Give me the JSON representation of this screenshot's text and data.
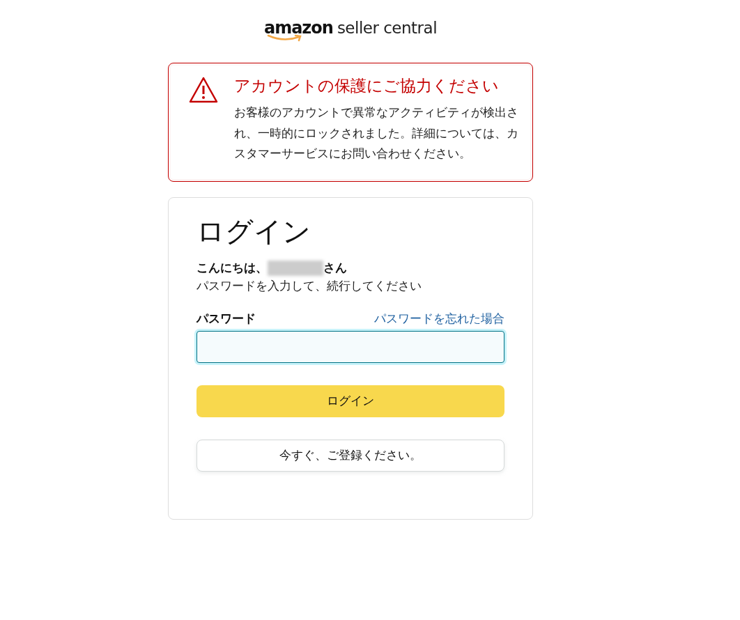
{
  "logo": {
    "brand": "amazon",
    "product": "seller central"
  },
  "alert": {
    "title": "アカウントの保護にご協力ください",
    "message": "お客様のアカウントで異常なアクティビティが検出され、一時的にロックされました。詳細については、カスタマーサービスにお問い合わせください。"
  },
  "login": {
    "heading": "ログイン",
    "greeting_prefix": "こんにちは、",
    "greeting_suffix": "さん",
    "name_redacted": true,
    "instruction": "パスワードを入力して、続行してください",
    "password_label": "パスワード",
    "forgot_link": "パスワードを忘れた場合",
    "password_focused": true,
    "login_button": "ログイン",
    "register_button": "今すぐ、ご登録ください。"
  }
}
